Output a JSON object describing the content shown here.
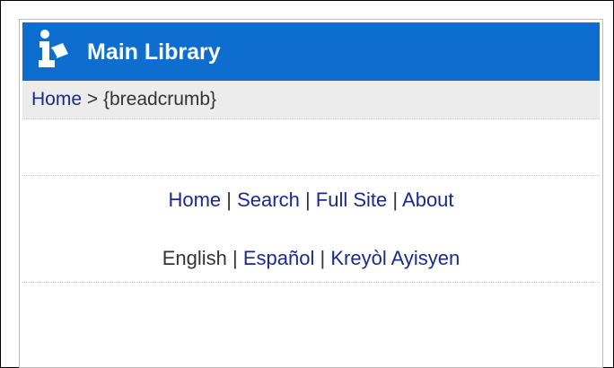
{
  "header": {
    "title": "Main Library",
    "logo_icon": "library-person-reading-icon",
    "background": "#0e6ed0"
  },
  "breadcrumb": {
    "home": "Home",
    "separator": ">",
    "current": "{breadcrumb}"
  },
  "nav": {
    "items": [
      "Home",
      "Search",
      "Full Site",
      "About"
    ],
    "separator": "|"
  },
  "languages": {
    "current": "English",
    "items": [
      "Español",
      "Kreyòl Ayisyen"
    ],
    "separator": "|"
  },
  "colors": {
    "link": "#1b2a8c",
    "text": "#333333",
    "breadcrumb_bg": "#ececec"
  }
}
